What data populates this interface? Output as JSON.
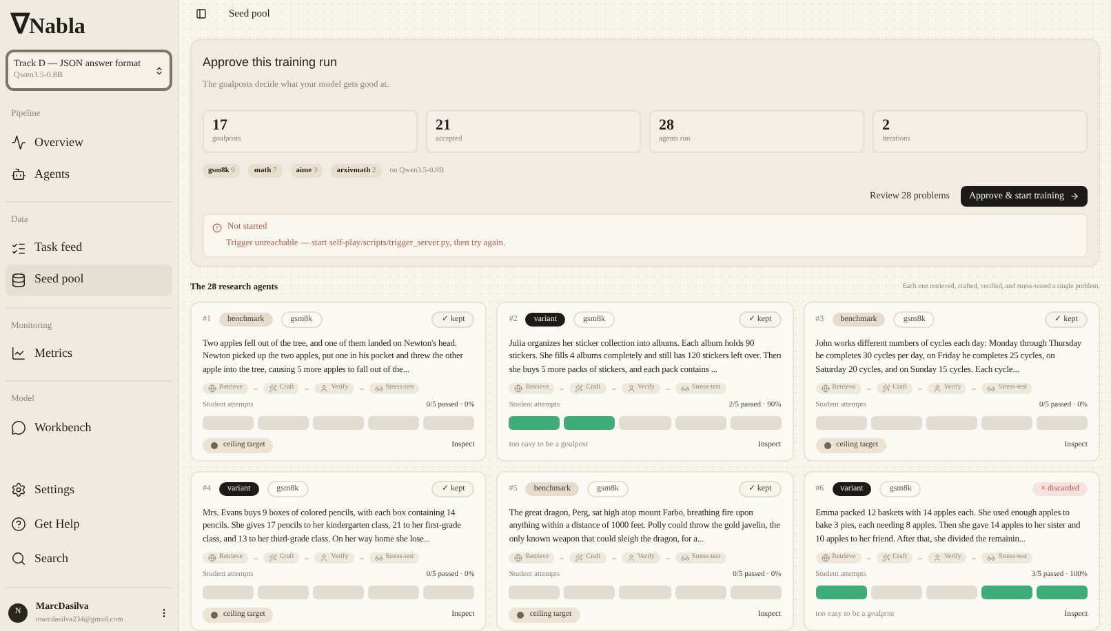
{
  "brand": {
    "logo": "∇",
    "name": "Nabla"
  },
  "track": {
    "title": "Track D — JSON answer format",
    "model": "Qwen3.5-0.8B"
  },
  "sidebar": {
    "sections": [
      {
        "heading": "Pipeline",
        "items": [
          {
            "label": "Overview",
            "selected": false
          },
          {
            "label": "Agents",
            "selected": false
          }
        ]
      },
      {
        "heading": "Data",
        "items": [
          {
            "label": "Task feed",
            "selected": false
          },
          {
            "label": "Seed pool",
            "selected": true
          }
        ]
      },
      {
        "heading": "Monitoring",
        "items": [
          {
            "label": "Metrics",
            "selected": false
          }
        ]
      },
      {
        "heading": "Model",
        "items": [
          {
            "label": "Workbench",
            "selected": false
          }
        ]
      }
    ],
    "footer_items": [
      {
        "label": "Settings"
      },
      {
        "label": "Get Help"
      },
      {
        "label": "Search"
      }
    ]
  },
  "user": {
    "initial": "N",
    "name": "MarcDasilva",
    "email": "marcdasilva234@gmail.com"
  },
  "breadcrumb": "Seed pool",
  "approval": {
    "title": "Approve this training run",
    "subtitle": "The goalposts decide what your model gets good at.",
    "stats": [
      {
        "value": "17",
        "label": "goalposts"
      },
      {
        "value": "21",
        "label": "accepted"
      },
      {
        "value": "28",
        "label": "agents run"
      },
      {
        "value": "2",
        "label": "iterations"
      }
    ],
    "sources": [
      {
        "name": "gsm8k",
        "count": "9"
      },
      {
        "name": "math",
        "count": "7"
      },
      {
        "name": "aime",
        "count": "3"
      },
      {
        "name": "arxivmath",
        "count": "2"
      }
    ],
    "model_note": "on Qwen3.5-0.8B",
    "review_button": "Review 28 problems",
    "approve_button": "Approve & start training",
    "alert": {
      "title": "Not started",
      "message": "Trigger unreachable — start self-play/scripts/trigger_server.py, then try again."
    }
  },
  "agents": {
    "title": "The 28 research agents",
    "subtitle": "Each one retrieved, crafted, verified, and stress-tested a single problem.",
    "cards": [
      {
        "number": "#1",
        "badge": {
          "kind": "benchmark",
          "label": "benchmark"
        },
        "source": "gsm8k",
        "status": {
          "kind": "kept",
          "label": "✓ kept"
        },
        "text": "Two apples fell out of the tree, and one of them landed on Newton's head. Newton picked up the two apples, put one in his pocket and threw the other apple into the tree, causing 5 more apples to fall out of the...",
        "steps": [
          "Retrieve",
          "Craft",
          "Verify",
          "Stress-test"
        ],
        "attempts_label": "Student attempts",
        "score": "0/5 passed · 0%",
        "attempts": [
          false,
          false,
          false,
          false,
          false
        ],
        "footer": {
          "kind": "tag",
          "text": "ceiling target"
        },
        "inspect": "Inspect"
      },
      {
        "number": "#2",
        "badge": {
          "kind": "variant",
          "label": "variant"
        },
        "source": "gsm8k",
        "status": {
          "kind": "kept",
          "label": "✓ kept"
        },
        "text": "Julia organizes her sticker collection into albums. Each album holds 90 stickers. She fills 4 albums completely and still has 120 stickers left over. Then she buys 5 more packs of stickers, and each pack contains ...",
        "steps": [
          "Retrieve",
          "Craft",
          "Verify",
          "Stress-test"
        ],
        "attempts_label": "Student attempts",
        "score": "2/5 passed · 90%",
        "attempts": [
          true,
          true,
          false,
          false,
          false
        ],
        "footer": {
          "kind": "note",
          "text": "too easy to be a goalpost"
        },
        "inspect": "Inspect"
      },
      {
        "number": "#3",
        "badge": {
          "kind": "benchmark",
          "label": "benchmark"
        },
        "source": "gsm8k",
        "status": {
          "kind": "kept",
          "label": "✓ kept"
        },
        "text": "John works different numbers of cycles each day: Monday through Thursday he completes 30 cycles per day, on Friday he completes 25 cycles, on Saturday 20 cycles, and on Sunday 15 cycles. Each cycle...",
        "steps": [
          "Retrieve",
          "Craft",
          "Verify",
          "Stress-test"
        ],
        "attempts_label": "Student attempts",
        "score": "0/5 passed · 0%",
        "attempts": [
          false,
          false,
          false,
          false,
          false
        ],
        "footer": {
          "kind": "tag",
          "text": "ceiling target"
        },
        "inspect": "Inspect"
      },
      {
        "number": "#4",
        "badge": {
          "kind": "variant",
          "label": "variant"
        },
        "source": "gsm8k",
        "status": {
          "kind": "kept",
          "label": "✓ kept"
        },
        "text": "Mrs. Evans buys 9 boxes of colored pencils, with each box containing 14 pencils. She gives 17 pencils to her kindergarten class, 21 to her first-grade class, and 13 to her third-grade class. On her way home she lose...",
        "steps": [
          "Retrieve",
          "Craft",
          "Verify",
          "Stress-test"
        ],
        "attempts_label": "Student attempts",
        "score": "0/5 passed · 0%",
        "attempts": [
          false,
          false,
          false,
          false,
          false
        ],
        "footer": {
          "kind": "tag",
          "text": "ceiling target"
        },
        "inspect": "Inspect"
      },
      {
        "number": "#5",
        "badge": {
          "kind": "benchmark",
          "label": "benchmark"
        },
        "source": "gsm8k",
        "status": {
          "kind": "kept",
          "label": "✓ kept"
        },
        "text": "The great dragon, Perg, sat high atop mount Farbo, breathing fire upon anything within a distance of 1000 feet. Polly could throw the gold javelin, the only known weapon that could sleigh the dragon, for a...",
        "steps": [
          "Retrieve",
          "Craft",
          "Verify",
          "Stress-test"
        ],
        "attempts_label": "Student attempts",
        "score": "0/5 passed · 0%",
        "attempts": [
          false,
          false,
          false,
          false,
          false
        ],
        "footer": {
          "kind": "tag",
          "text": "ceiling target"
        },
        "inspect": "Inspect"
      },
      {
        "number": "#6",
        "badge": {
          "kind": "variant",
          "label": "variant"
        },
        "source": "gsm8k",
        "status": {
          "kind": "discarded",
          "label": "× discarded"
        },
        "text": "Emma packed 12 baskets with 14 apples each. She used enough apples to bake 3 pies, each needing 8 apples. Then she gave 14 apples to her sister and 10 apples to her friend. After that, she divided the remainin...",
        "steps": [
          "Retrieve",
          "Craft",
          "Verify",
          "Stress-test"
        ],
        "attempts_label": "Student attempts",
        "score": "3/5 passed · 100%",
        "attempts": [
          true,
          false,
          false,
          true,
          true
        ],
        "footer": {
          "kind": "note",
          "text": "too easy to be a goalpost"
        },
        "inspect": "Inspect"
      }
    ]
  }
}
